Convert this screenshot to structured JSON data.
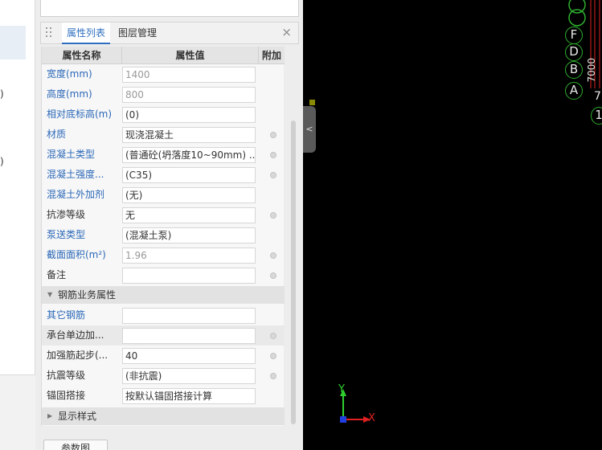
{
  "left_strip": {
    "paren_1": ")",
    "paren_2": ")"
  },
  "panel": {
    "tabs": [
      "属性列表",
      "图层管理"
    ],
    "close_symbol": "×",
    "columns": [
      "属性名称",
      "属性值",
      "附加"
    ],
    "rows": [
      {
        "label": "宽度(mm)",
        "value": "1400"
      },
      {
        "label": "高度(mm)",
        "value": "800"
      },
      {
        "label": "相对底标高(m)",
        "value": "(0)"
      },
      {
        "label": "材质",
        "value": "现浇混凝土"
      },
      {
        "label": "混凝土类型",
        "value": "(普通砼(坍落度10~90mm) ..."
      },
      {
        "label": "混凝土强度...",
        "value": "(C35)"
      },
      {
        "label": "混凝土外加剂",
        "value": "(无)"
      },
      {
        "label": "抗渗等级",
        "value": "无"
      },
      {
        "label": "泵送类型",
        "value": "(混凝土泵)"
      },
      {
        "label": "截面面积(m²)",
        "value": "1.96"
      },
      {
        "label": "备注",
        "value": ""
      }
    ],
    "section_rebar": "钢筋业务属性",
    "rebar_rows": [
      {
        "label": "其它钢筋",
        "value": ""
      },
      {
        "label": "承台单边加...",
        "value": ""
      },
      {
        "label": "加强筋起步(...",
        "value": "40"
      },
      {
        "label": "抗震等级",
        "value": "(非抗震)"
      },
      {
        "label": "锚固搭接",
        "value": "按默认锚固搭接计算"
      }
    ],
    "section_display": "显示样式",
    "bottom_button": "参数图"
  },
  "canvas": {
    "axis_labels": [
      "F",
      "D",
      "B",
      "A"
    ],
    "axis_x_label": "X",
    "axis_y_label": "Y",
    "numbers": [
      "7000",
      "7",
      "1"
    ]
  }
}
